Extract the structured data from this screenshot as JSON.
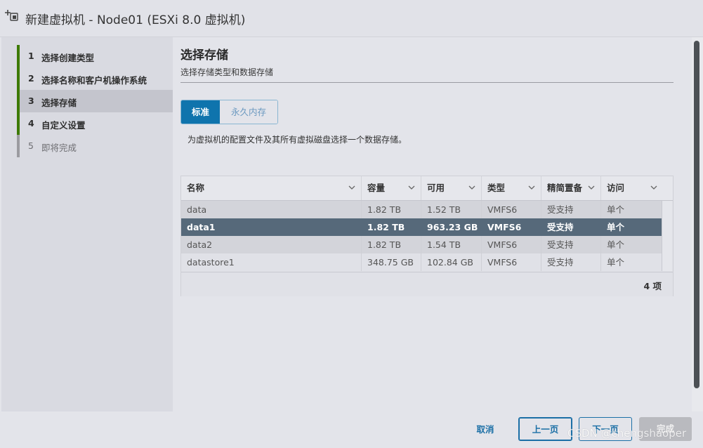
{
  "window": {
    "title": "新建虚拟机 - Node01 (ESXi 8.0 虚拟机)",
    "icon": "new-vm-icon"
  },
  "steps": [
    {
      "num": "1",
      "label": "选择创建类型",
      "state": "done"
    },
    {
      "num": "2",
      "label": "选择名称和客户机操作系统",
      "state": "done"
    },
    {
      "num": "3",
      "label": "选择存储",
      "state": "active"
    },
    {
      "num": "4",
      "label": "自定义设置",
      "state": "done"
    },
    {
      "num": "5",
      "label": "即将完成",
      "state": "future"
    }
  ],
  "page": {
    "title": "选择存储",
    "subtitle": "选择存储类型和数据存储",
    "tabs": [
      {
        "label": "标准",
        "selected": true
      },
      {
        "label": "永久内存",
        "selected": false
      }
    ],
    "description": "为虚拟机的配置文件及其所有虚拟磁盘选择一个数据存储。"
  },
  "table": {
    "columns": [
      "名称",
      "容量",
      "可用",
      "类型",
      "精简置备",
      "访问"
    ],
    "rows": [
      [
        "data",
        "1.82 TB",
        "1.52 TB",
        "VMFS6",
        "受支持",
        "单个"
      ],
      [
        "data1",
        "1.82 TB",
        "963.23 GB",
        "VMFS6",
        "受支持",
        "单个"
      ],
      [
        "data2",
        "1.82 TB",
        "1.54 TB",
        "VMFS6",
        "受支持",
        "单个"
      ],
      [
        "datastore1",
        "348.75 GB",
        "102.84 GB",
        "VMFS6",
        "受支持",
        "单个"
      ]
    ],
    "selected_row": 1,
    "count": "4 项"
  },
  "footer": {
    "cancel": "取消",
    "prev": "上一页",
    "next": "下一页",
    "finish": "完成"
  },
  "watermark": "CSDN @chengshaoper",
  "colors": {
    "accent": "#0f74ad",
    "step_done": "#3d7a00",
    "selected_row": "#56697a"
  }
}
